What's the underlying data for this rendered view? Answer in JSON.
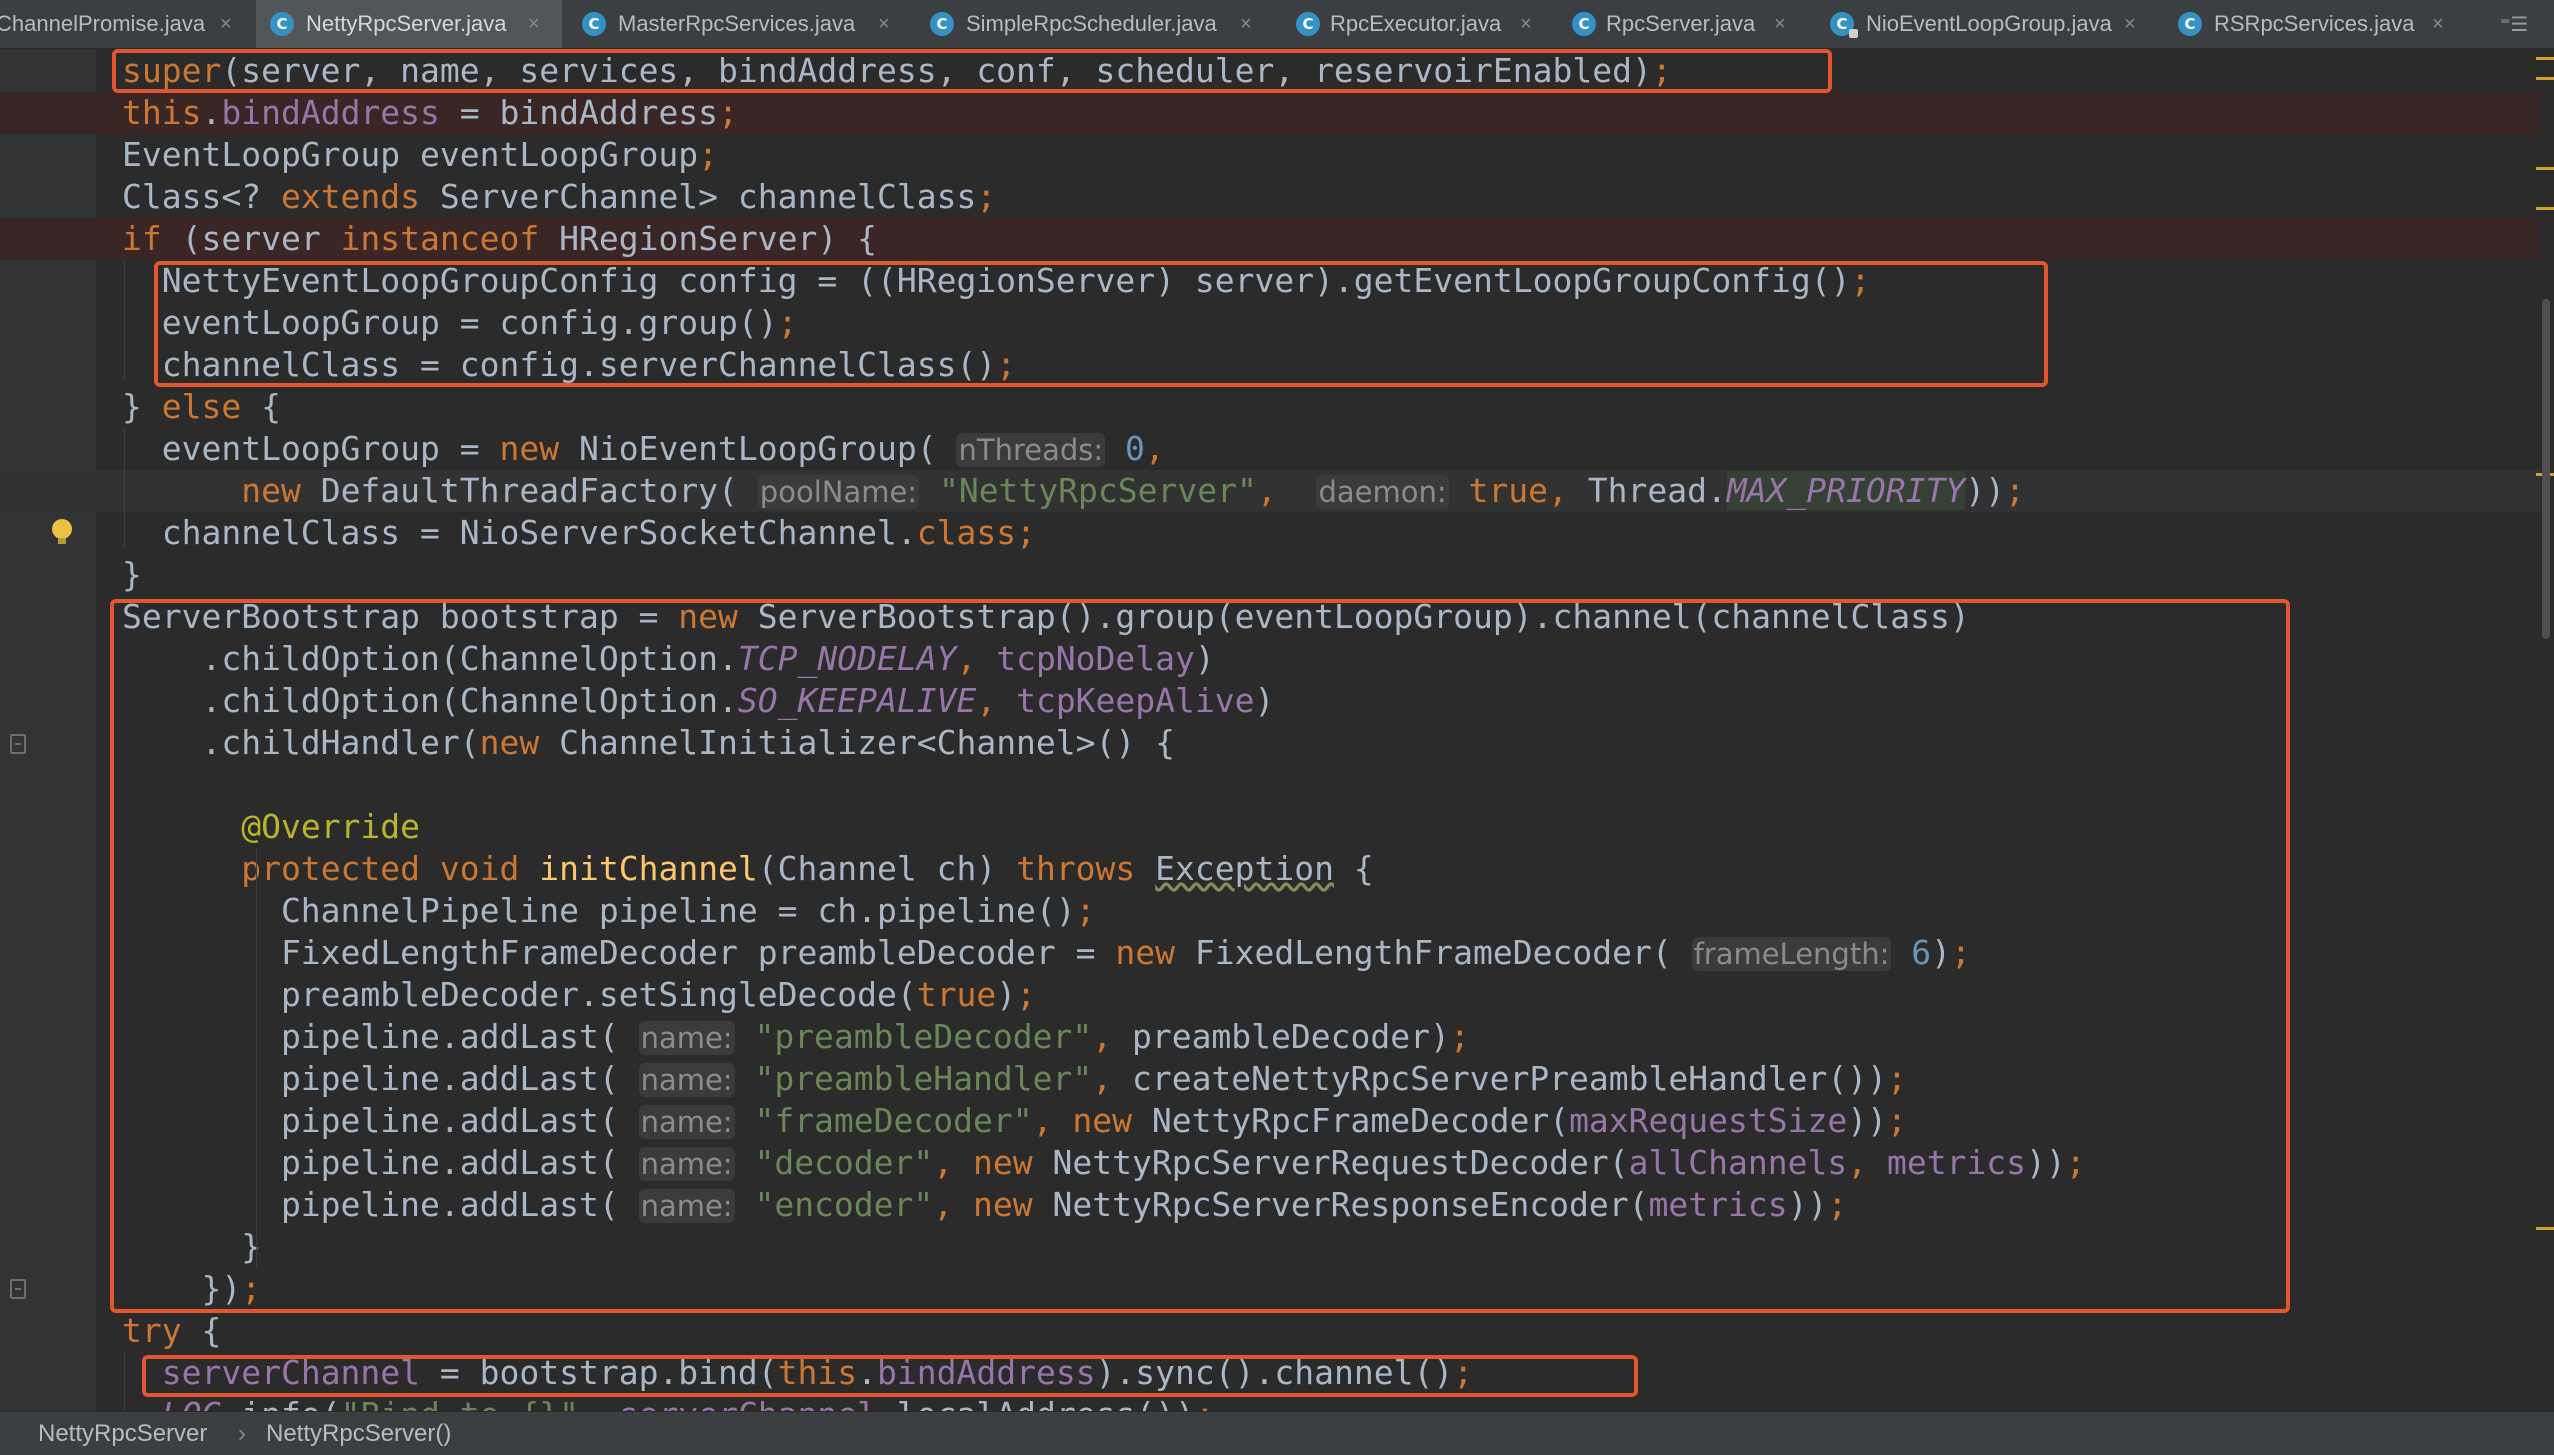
{
  "tabs": [
    {
      "label": "ChannelPromise.java",
      "active": false,
      "icon": "class-icon"
    },
    {
      "label": "NettyRpcServer.java",
      "active": true,
      "icon": "class-icon"
    },
    {
      "label": "MasterRpcServices.java",
      "active": false,
      "icon": "class-icon"
    },
    {
      "label": "SimpleRpcScheduler.java",
      "active": false,
      "icon": "class-icon"
    },
    {
      "label": "RpcExecutor.java",
      "active": false,
      "icon": "abstract-class-icon"
    },
    {
      "label": "RpcServer.java",
      "active": false,
      "icon": "abstract-class-icon"
    },
    {
      "label": "NioEventLoopGroup.java",
      "active": false,
      "icon": "locked-class-icon"
    },
    {
      "label": "RSRpcServices.java",
      "active": false,
      "icon": "class-icon"
    }
  ],
  "tab_close_glyph": "×",
  "tab_overflow_glyph": "⁼☰",
  "icon_letter": "C",
  "code_lines": [
    {
      "text": "super(server, name, services, bindAddress, conf, scheduler, reservoirEnabled);",
      "band": "none"
    },
    {
      "text": "this.bindAddress = bindAddress;",
      "band": "red"
    },
    {
      "text": "EventLoopGroup eventLoopGroup;",
      "band": "none"
    },
    {
      "text": "Class<? extends ServerChannel> channelClass;",
      "band": "none"
    },
    {
      "text": "if (server instanceof HRegionServer) {",
      "band": "red"
    },
    {
      "text": "  NettyEventLoopGroupConfig config = ((HRegionServer) server).getEventLoopGroupConfig();",
      "band": "none"
    },
    {
      "text": "  eventLoopGroup = config.group();",
      "band": "none"
    },
    {
      "text": "  channelClass = config.serverChannelClass();",
      "band": "none"
    },
    {
      "text": "} else {",
      "band": "none"
    },
    {
      "text": "  eventLoopGroup = new NioEventLoopGroup( nThreads: 0,",
      "band": "none"
    },
    {
      "text": "      new DefaultThreadFactory( poolName: \"NettyRpcServer\",  daemon: true, Thread.MAX_PRIORITY));",
      "band": "caret"
    },
    {
      "text": "  channelClass = NioServerSocketChannel.class;",
      "band": "none"
    },
    {
      "text": "}",
      "band": "none"
    },
    {
      "text": "ServerBootstrap bootstrap = new ServerBootstrap().group(eventLoopGroup).channel(channelClass)",
      "band": "none"
    },
    {
      "text": "    .childOption(ChannelOption.TCP_NODELAY, tcpNoDelay)",
      "band": "none"
    },
    {
      "text": "    .childOption(ChannelOption.SO_KEEPALIVE, tcpKeepAlive)",
      "band": "none"
    },
    {
      "text": "    .childHandler(new ChannelInitializer<Channel>() {",
      "band": "none"
    },
    {
      "text": "",
      "band": "none"
    },
    {
      "text": "      @Override",
      "band": "none"
    },
    {
      "text": "      protected void initChannel(Channel ch) throws Exception {",
      "band": "none"
    },
    {
      "text": "        ChannelPipeline pipeline = ch.pipeline();",
      "band": "none"
    },
    {
      "text": "        FixedLengthFrameDecoder preambleDecoder = new FixedLengthFrameDecoder( frameLength: 6);",
      "band": "none"
    },
    {
      "text": "        preambleDecoder.setSingleDecode(true);",
      "band": "none"
    },
    {
      "text": "        pipeline.addLast( name: \"preambleDecoder\", preambleDecoder);",
      "band": "none"
    },
    {
      "text": "        pipeline.addLast( name: \"preambleHandler\", createNettyRpcServerPreambleHandler());",
      "band": "none"
    },
    {
      "text": "        pipeline.addLast( name: \"frameDecoder\", new NettyRpcFrameDecoder(maxRequestSize));",
      "band": "none"
    },
    {
      "text": "        pipeline.addLast( name: \"decoder\", new NettyRpcServerRequestDecoder(allChannels, metrics));",
      "band": "none"
    },
    {
      "text": "        pipeline.addLast( name: \"encoder\", new NettyRpcServerResponseEncoder(metrics));",
      "band": "none"
    },
    {
      "text": "      }",
      "band": "none"
    },
    {
      "text": "    });",
      "band": "none"
    },
    {
      "text": "try {",
      "band": "none"
    },
    {
      "text": "  serverChannel = bootstrap.bind(this.bindAddress).sync().channel();",
      "band": "none"
    },
    {
      "text": "  LOG.info(\"Bind to {}\", serverChannel.localAddress());",
      "band": "none"
    }
  ],
  "breadcrumb": {
    "class_name": "NettyRpcServer",
    "separator": "›",
    "method_name": "NettyRpcServer()"
  },
  "colors": {
    "keyword": "#cc7832",
    "field": "#9876aa",
    "string": "#6a8759",
    "number": "#6897bb",
    "annotation": "#bbb529",
    "method_decl": "#ffc66d",
    "highlight_box": "#e4572e",
    "background": "#2b2b2b"
  }
}
